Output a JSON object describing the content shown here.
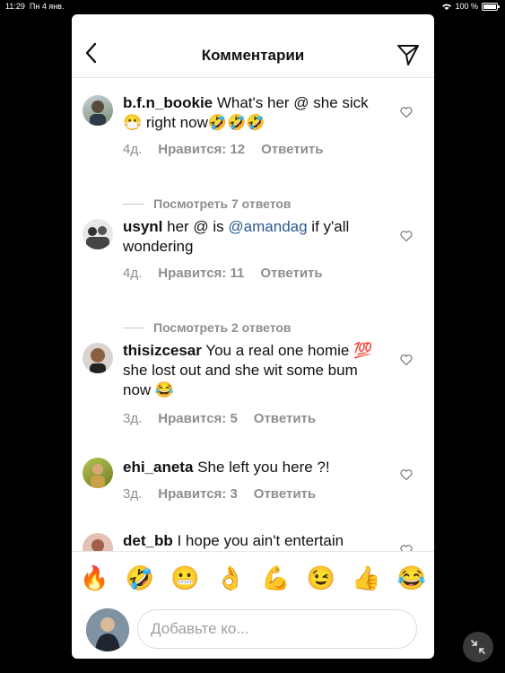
{
  "status_bar": {
    "time": "11:29",
    "date": "Пн 4 янв.",
    "battery": "100 %"
  },
  "header": {
    "title": "Комментарии"
  },
  "comments": [
    {
      "user": "b.f.n_bookie",
      "text": " What's her @ she sick 😷 right now🤣🤣🤣",
      "age": "4д.",
      "likes": "Нравится: 12",
      "reply": "Ответить",
      "view_replies": "Посмотреть 7 ответов"
    },
    {
      "user": "usynl",
      "text_before": " her @ is ",
      "mention": "@amandag",
      "text_after": " if y'all wondering",
      "age": "4д.",
      "likes": "Нравится: 11",
      "reply": "Ответить",
      "view_replies": "Посмотреть 2 ответов"
    },
    {
      "user": "thisizcesar",
      "text": " You a real one homie 💯 she lost out and she wit some bum now 😂",
      "age": "3д.",
      "likes": "Нравится: 5",
      "reply": "Ответить"
    },
    {
      "user": "ehi_aneta",
      "text": " She left you here ?!",
      "age": "3д.",
      "likes": "Нравится: 3",
      "reply": "Ответить"
    },
    {
      "user": "det_bb",
      "text": " I hope you ain't entertain"
    }
  ],
  "emoji_bar": [
    "🔥",
    "🤣",
    "😬",
    "👌",
    "💪",
    "😉",
    "👍",
    "😂"
  ],
  "composer": {
    "placeholder": "Добавьте ко..."
  },
  "icons": {
    "back": "chevron-left-icon",
    "share": "paper-plane-icon",
    "like": "heart-outline-icon",
    "minimize": "collapse-arrows-icon"
  }
}
